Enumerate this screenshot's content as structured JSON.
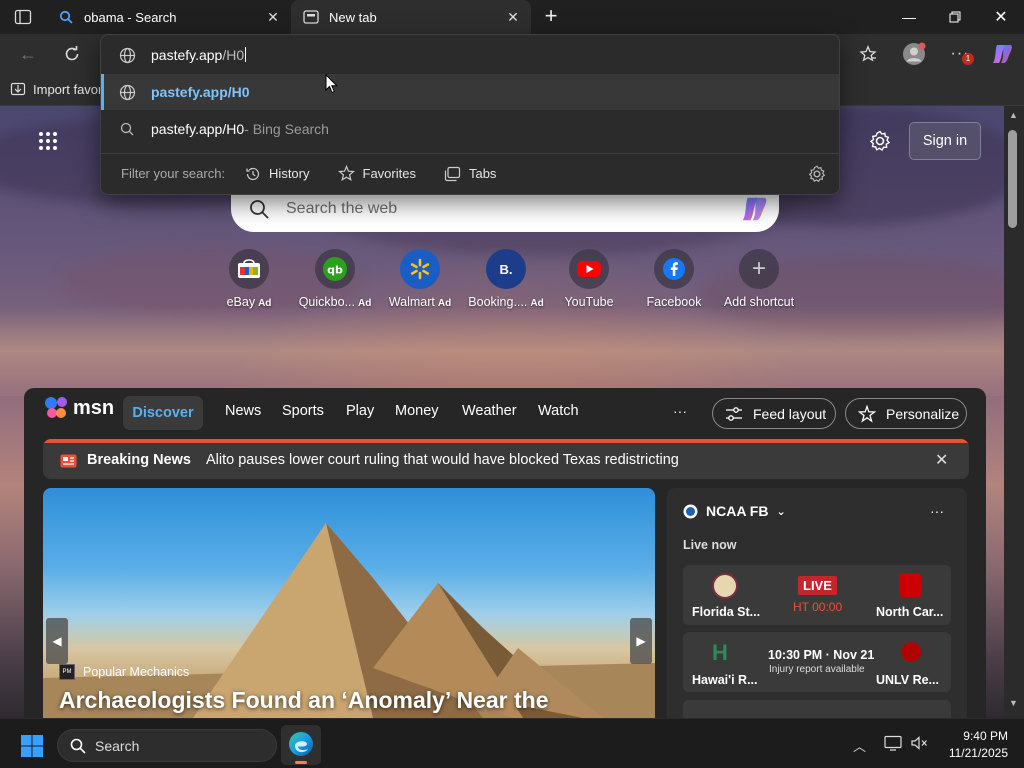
{
  "tabs": [
    {
      "title": "obama - Search",
      "icon": "search-icon",
      "active": false
    },
    {
      "title": "New tab",
      "icon": "newtab-icon",
      "active": true
    }
  ],
  "addressbar": {
    "typed": "pastefy.app/H0",
    "typed_host": "pastefy.app",
    "typed_path": "/H0"
  },
  "suggestions": [
    {
      "text": "pastefy.app/H0",
      "icon": "globe-icon",
      "suffix": ""
    },
    {
      "text": "pastefy.app/H0",
      "icon": "search-icon",
      "suffix": " - Bing Search"
    }
  ],
  "filter": {
    "label": "Filter your search:",
    "items": [
      {
        "label": "History",
        "icon": "history-icon"
      },
      {
        "label": "Favorites",
        "icon": "star-icon"
      },
      {
        "label": "Tabs",
        "icon": "tabs-icon"
      }
    ]
  },
  "favbar": {
    "import_label": "Import favor"
  },
  "newtab": {
    "signin": "Sign in",
    "search_placeholder": "Search the web",
    "quicklinks": [
      {
        "label": "eBay",
        "ad": "Ad",
        "icon": "ebay-icon"
      },
      {
        "label": "Quickbo...",
        "ad": "Ad",
        "icon": "quickbooks-icon"
      },
      {
        "label": "Walmart",
        "ad": "Ad",
        "icon": "walmart-icon"
      },
      {
        "label": "Booking....",
        "ad": "Ad",
        "icon": "booking-icon"
      },
      {
        "label": "YouTube",
        "ad": "",
        "icon": "youtube-icon"
      },
      {
        "label": "Facebook",
        "ad": "",
        "icon": "facebook-icon"
      },
      {
        "label": "Add shortcut",
        "ad": "",
        "icon": "plus-icon"
      }
    ]
  },
  "msn": {
    "logo": "msn",
    "nav": [
      "Discover",
      "News",
      "Sports",
      "Play",
      "Money",
      "Weather",
      "Watch"
    ],
    "more": "···",
    "feed_layout": "Feed layout",
    "personalize": "Personalize",
    "breaking_label": "Breaking News",
    "breaking_text": "Alito pauses lower court ruling that would have blocked Texas redistricting",
    "hero_source": "Popular Mechanics",
    "hero_title": "Archaeologists Found an ‘Anomaly’ Near the"
  },
  "sports": {
    "league": "NCAA FB",
    "live_now": "Live now",
    "more": "···",
    "games": [
      {
        "home": "Florida St...",
        "away": "North Car...",
        "status": "LIVE",
        "detail": "HT 00:00",
        "note": ""
      },
      {
        "home": "Hawai'i R...",
        "away": "UNLV Re...",
        "status": "",
        "detail": "10:30 PM · Nov 21",
        "note": "Injury report available"
      }
    ]
  },
  "taskbar": {
    "search": "Search",
    "time": "9:40 PM",
    "date": "11/21/2025"
  },
  "colors": {
    "accent": "#5ab0f0",
    "live": "#c4262e",
    "breaking_bar": "#e8523a"
  }
}
